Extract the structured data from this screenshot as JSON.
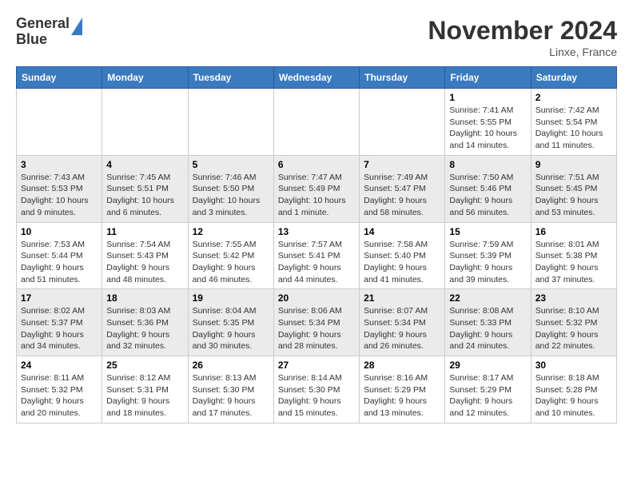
{
  "header": {
    "logo_line1": "General",
    "logo_line2": "Blue",
    "month": "November 2024",
    "location": "Linxe, France"
  },
  "weekdays": [
    "Sunday",
    "Monday",
    "Tuesday",
    "Wednesday",
    "Thursday",
    "Friday",
    "Saturday"
  ],
  "weeks": [
    [
      {
        "day": "",
        "info": ""
      },
      {
        "day": "",
        "info": ""
      },
      {
        "day": "",
        "info": ""
      },
      {
        "day": "",
        "info": ""
      },
      {
        "day": "",
        "info": ""
      },
      {
        "day": "1",
        "info": "Sunrise: 7:41 AM\nSunset: 5:55 PM\nDaylight: 10 hours and 14 minutes."
      },
      {
        "day": "2",
        "info": "Sunrise: 7:42 AM\nSunset: 5:54 PM\nDaylight: 10 hours and 11 minutes."
      }
    ],
    [
      {
        "day": "3",
        "info": "Sunrise: 7:43 AM\nSunset: 5:53 PM\nDaylight: 10 hours and 9 minutes."
      },
      {
        "day": "4",
        "info": "Sunrise: 7:45 AM\nSunset: 5:51 PM\nDaylight: 10 hours and 6 minutes."
      },
      {
        "day": "5",
        "info": "Sunrise: 7:46 AM\nSunset: 5:50 PM\nDaylight: 10 hours and 3 minutes."
      },
      {
        "day": "6",
        "info": "Sunrise: 7:47 AM\nSunset: 5:49 PM\nDaylight: 10 hours and 1 minute."
      },
      {
        "day": "7",
        "info": "Sunrise: 7:49 AM\nSunset: 5:47 PM\nDaylight: 9 hours and 58 minutes."
      },
      {
        "day": "8",
        "info": "Sunrise: 7:50 AM\nSunset: 5:46 PM\nDaylight: 9 hours and 56 minutes."
      },
      {
        "day": "9",
        "info": "Sunrise: 7:51 AM\nSunset: 5:45 PM\nDaylight: 9 hours and 53 minutes."
      }
    ],
    [
      {
        "day": "10",
        "info": "Sunrise: 7:53 AM\nSunset: 5:44 PM\nDaylight: 9 hours and 51 minutes."
      },
      {
        "day": "11",
        "info": "Sunrise: 7:54 AM\nSunset: 5:43 PM\nDaylight: 9 hours and 48 minutes."
      },
      {
        "day": "12",
        "info": "Sunrise: 7:55 AM\nSunset: 5:42 PM\nDaylight: 9 hours and 46 minutes."
      },
      {
        "day": "13",
        "info": "Sunrise: 7:57 AM\nSunset: 5:41 PM\nDaylight: 9 hours and 44 minutes."
      },
      {
        "day": "14",
        "info": "Sunrise: 7:58 AM\nSunset: 5:40 PM\nDaylight: 9 hours and 41 minutes."
      },
      {
        "day": "15",
        "info": "Sunrise: 7:59 AM\nSunset: 5:39 PM\nDaylight: 9 hours and 39 minutes."
      },
      {
        "day": "16",
        "info": "Sunrise: 8:01 AM\nSunset: 5:38 PM\nDaylight: 9 hours and 37 minutes."
      }
    ],
    [
      {
        "day": "17",
        "info": "Sunrise: 8:02 AM\nSunset: 5:37 PM\nDaylight: 9 hours and 34 minutes."
      },
      {
        "day": "18",
        "info": "Sunrise: 8:03 AM\nSunset: 5:36 PM\nDaylight: 9 hours and 32 minutes."
      },
      {
        "day": "19",
        "info": "Sunrise: 8:04 AM\nSunset: 5:35 PM\nDaylight: 9 hours and 30 minutes."
      },
      {
        "day": "20",
        "info": "Sunrise: 8:06 AM\nSunset: 5:34 PM\nDaylight: 9 hours and 28 minutes."
      },
      {
        "day": "21",
        "info": "Sunrise: 8:07 AM\nSunset: 5:34 PM\nDaylight: 9 hours and 26 minutes."
      },
      {
        "day": "22",
        "info": "Sunrise: 8:08 AM\nSunset: 5:33 PM\nDaylight: 9 hours and 24 minutes."
      },
      {
        "day": "23",
        "info": "Sunrise: 8:10 AM\nSunset: 5:32 PM\nDaylight: 9 hours and 22 minutes."
      }
    ],
    [
      {
        "day": "24",
        "info": "Sunrise: 8:11 AM\nSunset: 5:32 PM\nDaylight: 9 hours and 20 minutes."
      },
      {
        "day": "25",
        "info": "Sunrise: 8:12 AM\nSunset: 5:31 PM\nDaylight: 9 hours and 18 minutes."
      },
      {
        "day": "26",
        "info": "Sunrise: 8:13 AM\nSunset: 5:30 PM\nDaylight: 9 hours and 17 minutes."
      },
      {
        "day": "27",
        "info": "Sunrise: 8:14 AM\nSunset: 5:30 PM\nDaylight: 9 hours and 15 minutes."
      },
      {
        "day": "28",
        "info": "Sunrise: 8:16 AM\nSunset: 5:29 PM\nDaylight: 9 hours and 13 minutes."
      },
      {
        "day": "29",
        "info": "Sunrise: 8:17 AM\nSunset: 5:29 PM\nDaylight: 9 hours and 12 minutes."
      },
      {
        "day": "30",
        "info": "Sunrise: 8:18 AM\nSunset: 5:28 PM\nDaylight: 9 hours and 10 minutes."
      }
    ]
  ]
}
